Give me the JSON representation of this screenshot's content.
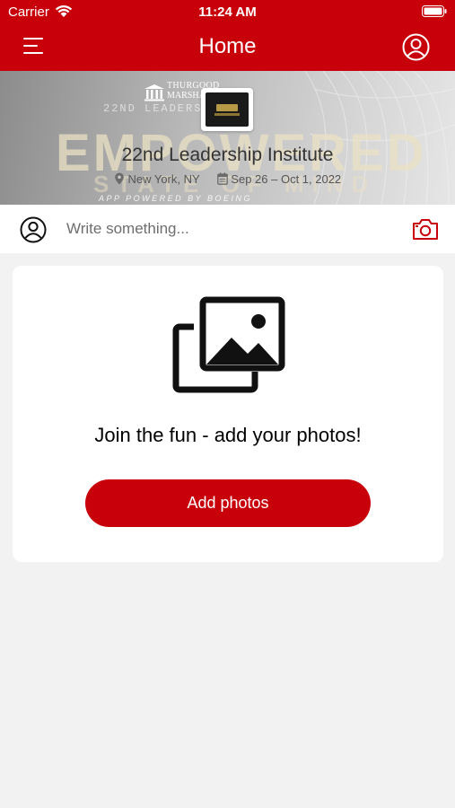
{
  "status_bar": {
    "carrier": "Carrier",
    "time": "11:24 AM",
    "icons": [
      "wifi-icon",
      "battery-icon"
    ]
  },
  "nav": {
    "title": "Home",
    "menu_icon": "hamburger-menu-icon",
    "profile_icon": "user-circle-icon"
  },
  "banner": {
    "org_name_line1": "THURGOOD",
    "org_name_line2": "MARSHALL",
    "background_subtitle": "22ND LEADERSHIP",
    "background_headline": "EMPOWERED",
    "background_tagline": "STATE OF MIND",
    "powered_by": "APP POWERED BY BOEING",
    "event_title": "22nd Leadership Institute",
    "location": "New York, NY",
    "dates": "Sep 26 – Oct 1, 2022"
  },
  "composer": {
    "placeholder": "Write something...",
    "value": "",
    "avatar_icon": "user-circle-icon",
    "camera_icon": "camera-icon"
  },
  "photos_card": {
    "icon": "photo-gallery-icon",
    "message": "Join the fun - add your photos!",
    "button_label": "Add photos"
  },
  "colors": {
    "brand_red": "#c8000a",
    "page_background": "#f2f2f2",
    "card_background": "#ffffff"
  }
}
